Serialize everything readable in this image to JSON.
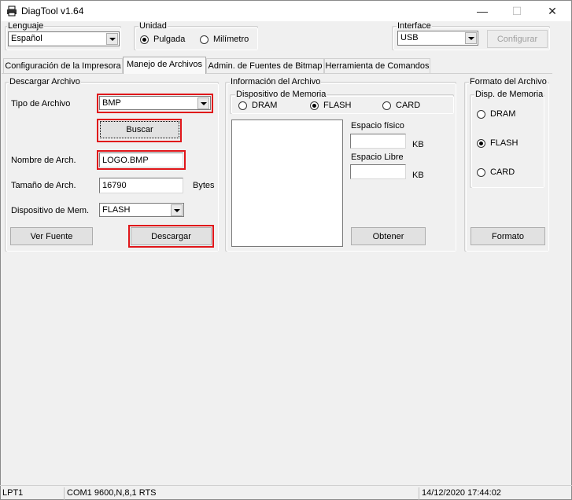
{
  "window": {
    "title": "DiagTool v1.64",
    "minimize": "—",
    "maximize": "☐",
    "close": "✕"
  },
  "lenguaje": {
    "legend": "Lenguaje",
    "value": "Español"
  },
  "unidad": {
    "legend": "Unidad",
    "options": [
      "Pulgada",
      "Milímetro"
    ],
    "selected": "Pulgada"
  },
  "interface": {
    "legend": "Interface",
    "value": "USB",
    "configurar": "Configurar"
  },
  "tabs": [
    {
      "label": "Configuración de la Impresora",
      "active": false
    },
    {
      "label": "Manejo de Archivos",
      "active": true
    },
    {
      "label": "Admin. de Fuentes de Bitmap",
      "active": false
    },
    {
      "label": "Herramienta de Comandos",
      "active": false
    }
  ],
  "descargar": {
    "legend": "Descargar Archivo",
    "tipo_label": "Tipo de Archivo",
    "tipo_value": "BMP",
    "buscar": "Buscar",
    "nombre_label": "Nombre de Arch.",
    "nombre_value": "LOGO.BMP",
    "tamano_label": "Tamaño de Arch.",
    "tamano_value": "16790",
    "tamano_unit": "Bytes",
    "dispositivo_label": "Dispositivo de Mem.",
    "dispositivo_value": "FLASH",
    "ver_fuente": "Ver Fuente",
    "descargar": "Descargar"
  },
  "informacion": {
    "legend": "Información del Archivo",
    "mem_legend": "Dispositivo de Memoria",
    "options": [
      "DRAM",
      "FLASH",
      "CARD"
    ],
    "selected": "FLASH",
    "espacio_fisico": "Espacio físico",
    "espacio_libre": "Espacio Libre",
    "kb": "KB",
    "obtener": "Obtener"
  },
  "formato": {
    "legend": "Formato del Archivo",
    "mem_legend": "Disp. de Memoria",
    "options": [
      "DRAM",
      "FLASH",
      "CARD"
    ],
    "selected": "FLASH",
    "button": "Formato"
  },
  "status": {
    "port": "LPT1",
    "com": "COM1 9600,N,8,1 RTS",
    "datetime": "14/12/2020 17:44:02"
  },
  "colors": {
    "highlight": "#e0161a",
    "window_bg": "#f0f0f0"
  }
}
